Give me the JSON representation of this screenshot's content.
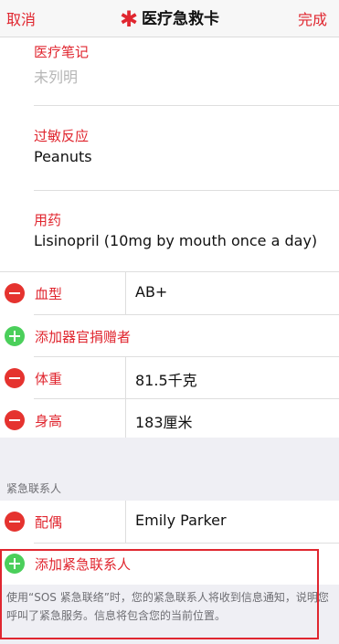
{
  "nav": {
    "cancel_label": "取消",
    "title": "医疗急救卡",
    "done_label": "完成"
  },
  "medical_notes": {
    "label": "医疗笔记",
    "value": "未列明"
  },
  "allergies": {
    "label": "过敏反应",
    "value": "Peanuts"
  },
  "medications": {
    "label": "用药",
    "value": "Lisinopril (10mg by mouth once a day)"
  },
  "rows": {
    "blood_type": {
      "label": "血型",
      "value": "AB+"
    },
    "add_organ_donor": {
      "label": "添加器官捐赠者"
    },
    "weight": {
      "label": "体重",
      "value": "81.5千克"
    },
    "height": {
      "label": "身高",
      "value": "183厘米"
    }
  },
  "emergency_contacts": {
    "header": "紧急联系人",
    "contact": {
      "relation": "配偶",
      "name": "Emily Parker"
    },
    "add_label": "添加紧急联系人",
    "footer": "使用“SOS 紧急联络”时，您的紧急联系人将收到信息通知，说明您呼叫了紧急服务。信息将包含您的当前位置。"
  },
  "colors": {
    "accent": "#e0262f",
    "add_green": "#4bcf5b",
    "remove_red": "#e5332f"
  }
}
